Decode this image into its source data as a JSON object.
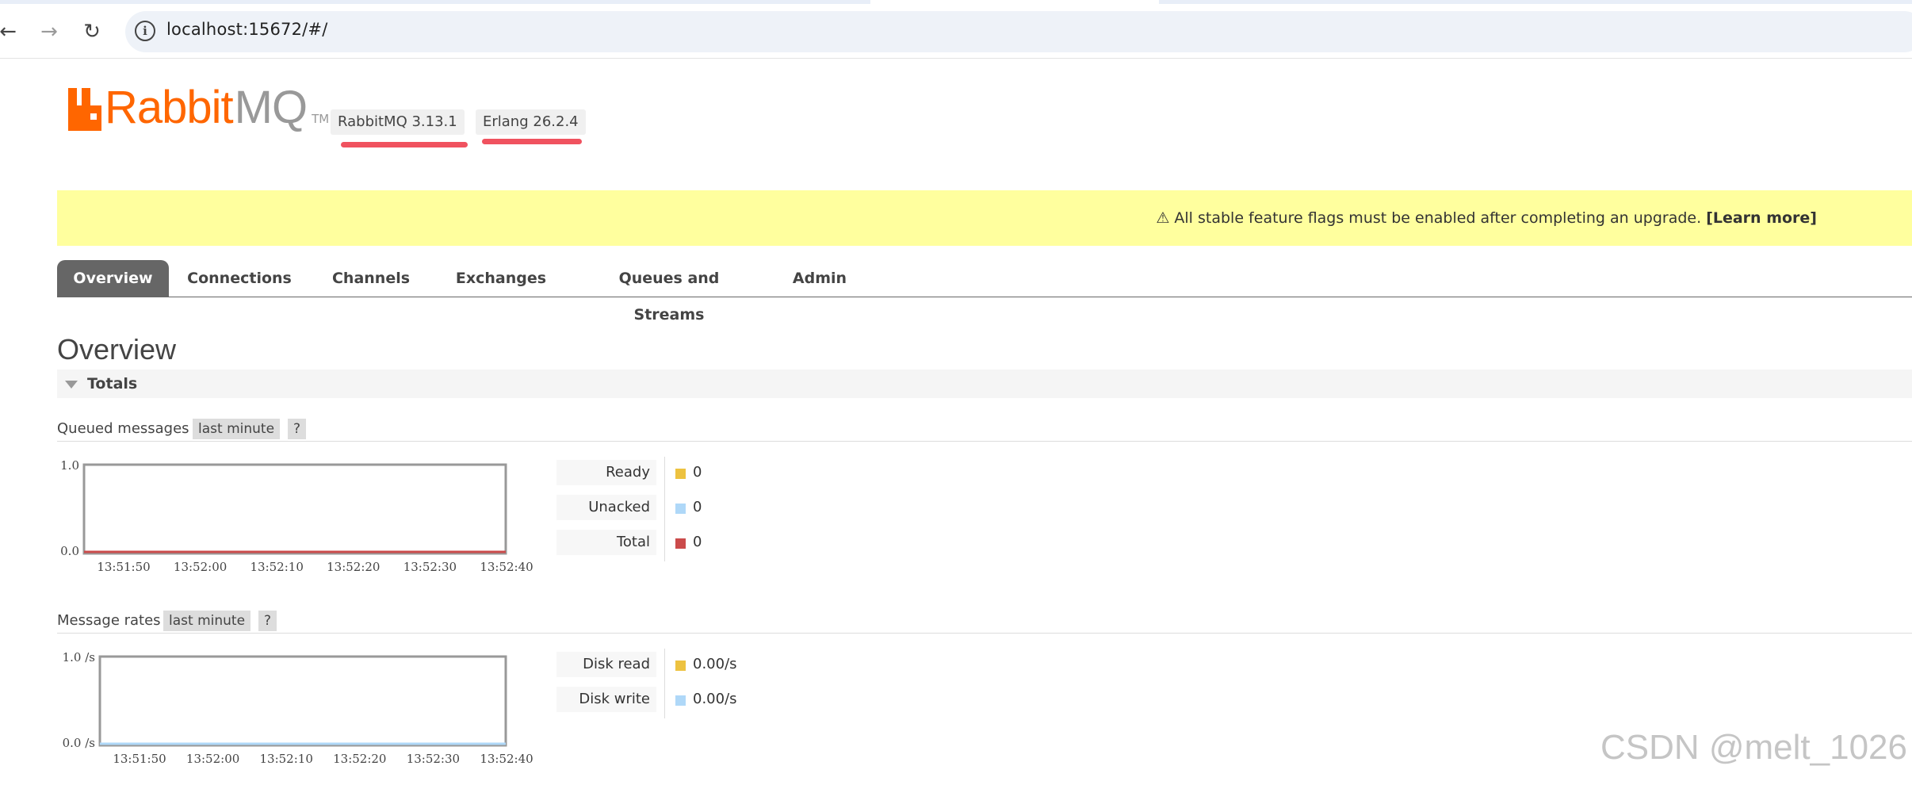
{
  "browser": {
    "url": "localhost:15672/#/",
    "back_icon": "arrow-left-icon",
    "forward_icon": "arrow-right-icon",
    "reload_icon": "reload-icon",
    "site_info_icon": "info-icon"
  },
  "header": {
    "logo_text_main": "Rabbit",
    "logo_text_accent": "MQ",
    "logo_tm": "TM",
    "rabbitmq_version": "RabbitMQ 3.13.1",
    "erlang_version": "Erlang 26.2.4"
  },
  "banner": {
    "warning_icon": "⚠",
    "message": "All stable feature flags must be enabled after completing an upgrade.",
    "link_text": "[Learn more]"
  },
  "tabs": [
    {
      "label": "Overview",
      "active": true
    },
    {
      "label": "Connections",
      "active": false
    },
    {
      "label": "Channels",
      "active": false
    },
    {
      "label": "Exchanges",
      "active": false
    },
    {
      "label": "Queues and Streams",
      "active": false
    },
    {
      "label": "Admin",
      "active": false
    }
  ],
  "page": {
    "title": "Overview",
    "section": "Totals"
  },
  "queued_messages": {
    "label": "Queued messages",
    "range": "last minute",
    "help": "?",
    "stats": [
      {
        "label": "Ready",
        "value": "0",
        "color": "#edc240"
      },
      {
        "label": "Unacked",
        "value": "0",
        "color": "#afd8f8"
      },
      {
        "label": "Total",
        "value": "0",
        "color": "#cb4b4b"
      }
    ]
  },
  "message_rates": {
    "label": "Message rates",
    "range": "last minute",
    "help": "?",
    "stats": [
      {
        "label": "Disk read",
        "value": "0.00/s",
        "color": "#edc240"
      },
      {
        "label": "Disk write",
        "value": "0.00/s",
        "color": "#afd8f8"
      }
    ]
  },
  "chart_data": [
    {
      "type": "line",
      "x": [
        "13:51:50",
        "13:52:00",
        "13:52:10",
        "13:52:20",
        "13:52:30",
        "13:52:40"
      ],
      "y_ticks": [
        "0.0",
        "1.0"
      ],
      "ylim": [
        0,
        1
      ],
      "series": [
        {
          "name": "Ready",
          "values": [
            0,
            0,
            0,
            0,
            0,
            0
          ],
          "color": "#edc240"
        },
        {
          "name": "Unacked",
          "values": [
            0,
            0,
            0,
            0,
            0,
            0
          ],
          "color": "#afd8f8"
        },
        {
          "name": "Total",
          "values": [
            0,
            0,
            0,
            0,
            0,
            0
          ],
          "color": "#cb4b4b"
        }
      ]
    },
    {
      "type": "line",
      "x": [
        "13:51:50",
        "13:52:00",
        "13:52:10",
        "13:52:20",
        "13:52:30",
        "13:52:40"
      ],
      "y_ticks": [
        "0.0 /s",
        "1.0 /s"
      ],
      "ylim": [
        0,
        1
      ],
      "series": [
        {
          "name": "Disk read",
          "values": [
            0,
            0,
            0,
            0,
            0,
            0
          ],
          "color": "#edc240"
        },
        {
          "name": "Disk write",
          "values": [
            0,
            0,
            0,
            0,
            0,
            0
          ],
          "color": "#afd8f8"
        }
      ]
    }
  ],
  "watermark": "CSDN @melt_1026"
}
